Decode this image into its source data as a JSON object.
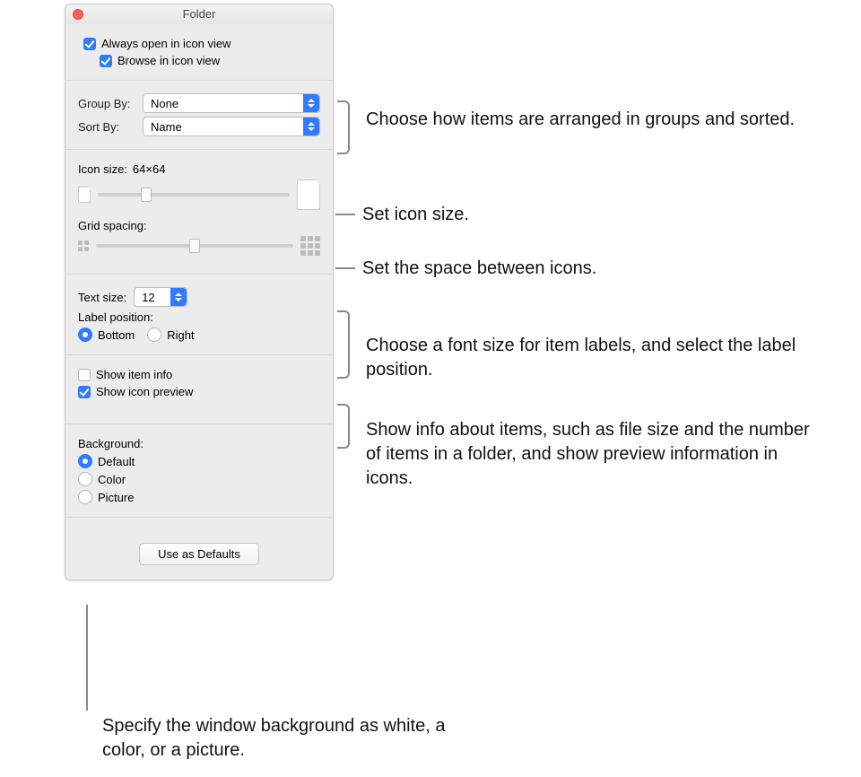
{
  "window": {
    "title": "Folder"
  },
  "view": {
    "always_open_label": "Always open in icon view",
    "always_open_checked": true,
    "browse_label": "Browse in icon view",
    "browse_checked": true
  },
  "arrange": {
    "group_by_label": "Group By:",
    "group_by_value": "None",
    "sort_by_label": "Sort By:",
    "sort_by_value": "Name"
  },
  "icon": {
    "size_label": "Icon size:",
    "size_value": "64×64",
    "size_percent": 25,
    "grid_label": "Grid spacing:",
    "grid_percent": 50
  },
  "text": {
    "size_label": "Text size:",
    "size_value": "12",
    "position_label": "Label position:",
    "bottom_label": "Bottom",
    "right_label": "Right",
    "position_selected": "bottom"
  },
  "info": {
    "item_info_label": "Show item info",
    "item_info_checked": false,
    "icon_preview_label": "Show icon preview",
    "icon_preview_checked": true
  },
  "background": {
    "heading": "Background:",
    "default_label": "Default",
    "color_label": "Color",
    "picture_label": "Picture",
    "selected": "default"
  },
  "footer": {
    "use_defaults_label": "Use as Defaults"
  },
  "annotations": {
    "arrange": "Choose how items are arranged in groups and sorted.",
    "icon_size": "Set icon size.",
    "grid_spacing": "Set the space between icons.",
    "text": "Choose a font size for item labels, and select the label position.",
    "info": "Show info about items, such as file size and the number of items in a folder, and show preview information in icons.",
    "background": "Specify the window background as white, a color, or a picture."
  }
}
